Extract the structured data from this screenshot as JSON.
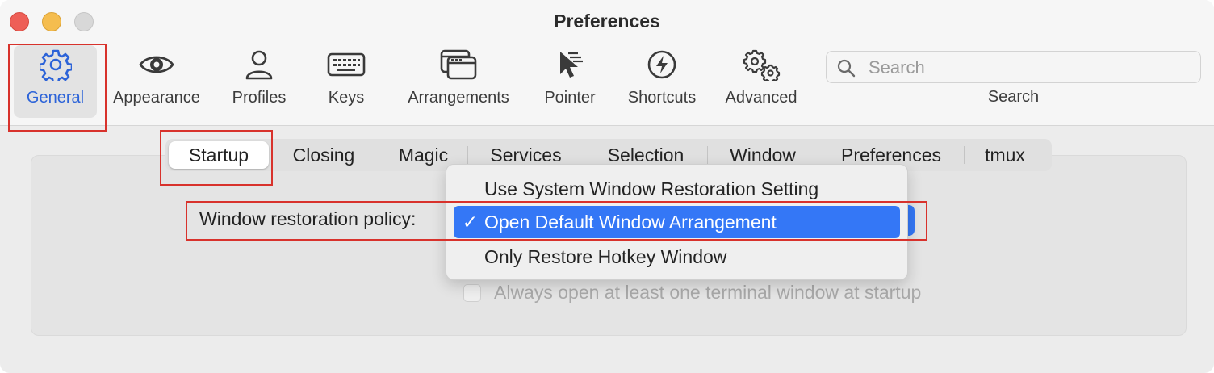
{
  "window": {
    "title": "Preferences"
  },
  "toolbar": {
    "items": [
      {
        "label": "General",
        "icon": "gear-icon",
        "selected": true
      },
      {
        "label": "Appearance",
        "icon": "eye-icon"
      },
      {
        "label": "Profiles",
        "icon": "person-icon"
      },
      {
        "label": "Keys",
        "icon": "keyboard-icon"
      },
      {
        "label": "Arrangements",
        "icon": "windows-icon"
      },
      {
        "label": "Pointer",
        "icon": "pointer-icon"
      },
      {
        "label": "Shortcuts",
        "icon": "bolt-icon"
      },
      {
        "label": "Advanced",
        "icon": "gears-icon"
      }
    ],
    "search": {
      "placeholder": "Search",
      "caption": "Search"
    }
  },
  "tabs": [
    "Startup",
    "Closing",
    "Magic",
    "Services",
    "Selection",
    "Window",
    "Preferences",
    "tmux"
  ],
  "active_tab": "Startup",
  "startup": {
    "policy_label": "Window restoration policy:",
    "menu_options": [
      "Use System Window Restoration Setting",
      "Open Default Window Arrangement",
      "Only Restore Hotkey Window"
    ],
    "selected_option": "Open Default Window Arrangement",
    "check_mark": "✓",
    "checkbox_label": "Always open at least one terminal window at startup"
  },
  "colors": {
    "accent": "#3477f6",
    "selected_label": "#2c63d8",
    "annotation": "#d8322c"
  }
}
